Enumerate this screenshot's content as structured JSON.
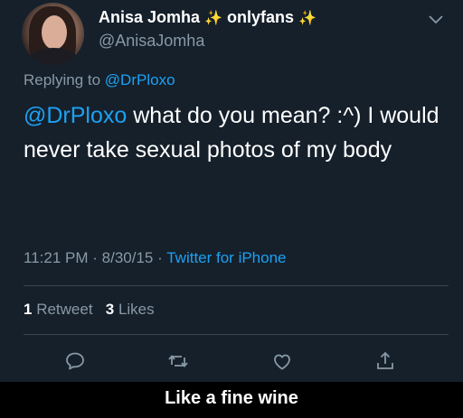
{
  "tweet": {
    "author": {
      "display_name": "Anisa Jomha",
      "name_suffix_word": "onlyfans",
      "sparkle_emoji": "✨",
      "handle": "@AnisaJomha"
    },
    "replying_prefix": "Replying to",
    "replying_to": "@DrPloxo",
    "body": {
      "mention": "@DrPloxo",
      "text": " what do you mean? :^) I would never take sexual photos of my body"
    },
    "meta": {
      "time": "11:21 PM",
      "separator": "·",
      "date": "8/30/15",
      "source": "Twitter for iPhone"
    },
    "stats": {
      "retweets_count": "1",
      "retweets_label": "Retweet",
      "likes_count": "3",
      "likes_label": "Likes"
    },
    "actions": [
      "reply-icon",
      "retweet-icon",
      "like-icon",
      "share-icon"
    ]
  },
  "caption": "Like a fine wine",
  "colors": {
    "background": "#15202b",
    "accent": "#1da1f2",
    "muted": "#8899a6",
    "divider": "#38444d"
  }
}
